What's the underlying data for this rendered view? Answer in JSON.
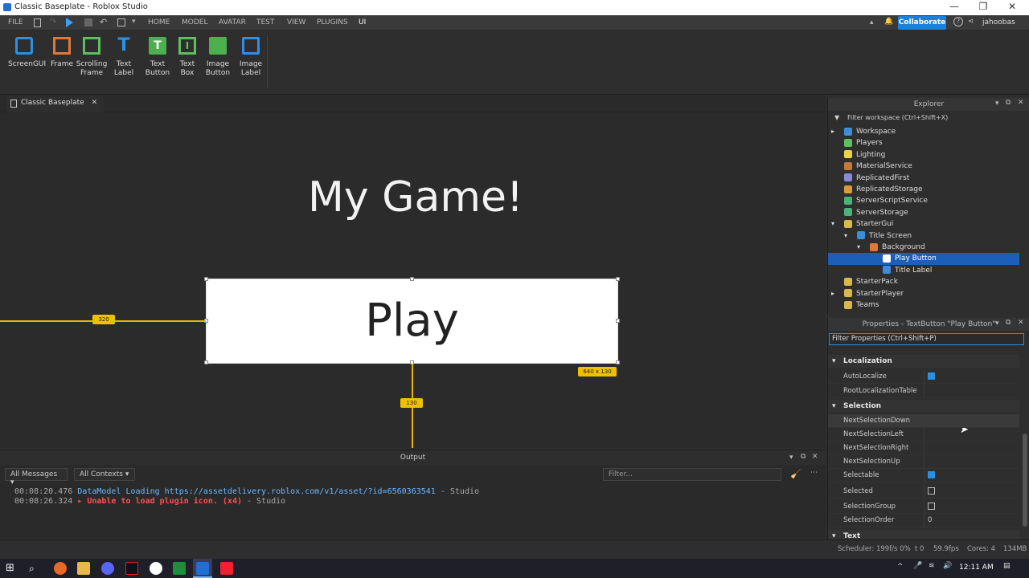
{
  "window": {
    "title": "Classic Baseplate - Roblox Studio"
  },
  "menubar": {
    "file": "FILE",
    "tabs": [
      "HOME",
      "MODEL",
      "AVATAR",
      "TEST",
      "VIEW",
      "PLUGINS",
      "UI"
    ],
    "collaborate": "Collaborate",
    "user": "jahoobas"
  },
  "ribbon": {
    "buttons": [
      {
        "l1": "ScreenGUI",
        "l2": ""
      },
      {
        "l1": "Frame",
        "l2": ""
      },
      {
        "l1": "Scrolling",
        "l2": "Frame"
      },
      {
        "l1": "Text",
        "l2": "Label"
      },
      {
        "l1": "Text",
        "l2": "Button"
      },
      {
        "l1": "Text",
        "l2": "Box"
      },
      {
        "l1": "Image",
        "l2": "Button"
      },
      {
        "l1": "Image",
        "l2": "Label"
      }
    ]
  },
  "doc": {
    "tab": "Classic Baseplate"
  },
  "viewport": {
    "title": "My Game!",
    "button": "Play",
    "dist_left": "320",
    "size": "640 x 130",
    "dist_bottom": "130"
  },
  "output": {
    "title": "Output",
    "filter1": "All Messages",
    "filter2": "All Contexts",
    "filter_placeholder": "Filter...",
    "lines": [
      {
        "time": "00:08:20.476",
        "msg": "DataModel Loading https://assetdelivery.roblox.com/v1/asset/?id=6560363541",
        "src": "  -  Studio"
      },
      {
        "time": "00:08:26.324",
        "msg": "▸ Unable to load plugin icon. (x4)",
        "src": "  -  Studio"
      }
    ]
  },
  "explorer": {
    "title": "Explorer",
    "filter": "Filter workspace (Ctrl+Shift+X)",
    "items": [
      {
        "n": "Workspace",
        "c": "#3b8fd9"
      },
      {
        "n": "Players",
        "c": "#5fbf5f"
      },
      {
        "n": "Lighting",
        "c": "#e8d24a"
      },
      {
        "n": "MaterialService",
        "c": "#c07a3a"
      },
      {
        "n": "ReplicatedFirst",
        "c": "#8a8ad8"
      },
      {
        "n": "ReplicatedStorage",
        "c": "#d89a3a"
      },
      {
        "n": "ServerScriptService",
        "c": "#4ab27a"
      },
      {
        "n": "ServerStorage",
        "c": "#4ab27a"
      },
      {
        "n": "StarterGui",
        "c": "#d8b84a"
      },
      {
        "n": "Title Screen",
        "c": "#3b8fd9"
      },
      {
        "n": "Background",
        "c": "#e0783a"
      },
      {
        "n": "Play Button",
        "c": "#ffffff"
      },
      {
        "n": "Title Label",
        "c": "#3b8fd9"
      },
      {
        "n": "StarterPack",
        "c": "#d8b84a"
      },
      {
        "n": "StarterPlayer",
        "c": "#d8b84a"
      },
      {
        "n": "Teams",
        "c": "#d8b84a"
      }
    ]
  },
  "properties": {
    "title": "Properties - TextButton \"Play Button\"",
    "filter": "Filter Properties (Ctrl+Shift+P)",
    "sections": [
      "Localization",
      "Selection",
      "Text"
    ],
    "rows": [
      {
        "n": "AutoLocalize",
        "v": "check-on"
      },
      {
        "n": "RootLocalizationTable",
        "v": ""
      },
      {
        "n": "NextSelectionDown",
        "v": ""
      },
      {
        "n": "NextSelectionLeft",
        "v": ""
      },
      {
        "n": "NextSelectionRight",
        "v": ""
      },
      {
        "n": "NextSelectionUp",
        "v": ""
      },
      {
        "n": "Selectable",
        "v": "check-on"
      },
      {
        "n": "Selected",
        "v": "check-off"
      },
      {
        "n": "SelectionGroup",
        "v": "check-off"
      },
      {
        "n": "SelectionOrder",
        "v": "0"
      }
    ]
  },
  "status": {
    "scheduler": "Scheduler: 199f/s 0%",
    "t": "t 0",
    "fps": "59.9fps",
    "cores": "Cores: 4",
    "mem": "134MB"
  },
  "taskbar": {
    "time": "12:11 AM"
  }
}
